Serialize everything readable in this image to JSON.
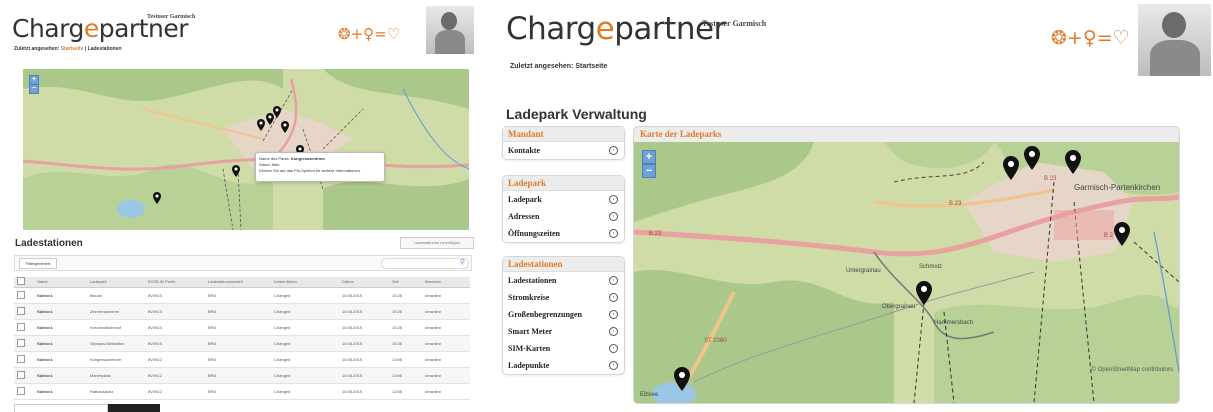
{
  "left": {
    "logo": {
      "pre": "Charg",
      "hi": "e",
      "post": "partner"
    },
    "user": "Testuser Garmisch",
    "deco": "❂+♀=♡",
    "breadcrumb": {
      "recent": "Zuletzt angesehen:",
      "current": "Startseite",
      "sep": "|",
      "other": "Ladestationen"
    },
    "map": {
      "zoom_in": "+",
      "zoom_out": "−",
      "popup": {
        "line1_pre": "Name des Parks:",
        "line1_name": "Kongresszentrum",
        "line2": "Stand: Italo",
        "line3": "Klicken Sie auf das Pin-Symbol für weitere Informationen."
      }
    },
    "section_title": "Ladestationen",
    "add_button": "Ladestationen hinzufügen",
    "filter_tab": "Filtergeneriert",
    "table": {
      "headers": [
        "",
        "Name",
        "Ladepark",
        "EVSE-ID Prefix",
        "Ladestationsmodell",
        "Letzte Aktion",
        "Datum",
        "Zeit",
        "Benutzer"
      ],
      "rows": [
        [
          "",
          "Station1",
          "Bisuse",
          "8V1€13",
          "BRS",
          "Changed",
          "15.06.2015",
          "13:26",
          "crowdinn"
        ],
        [
          "",
          "Station1",
          "Zinnermanzome",
          "8V1€13",
          "BRS",
          "Changed",
          "15.06.2015",
          "13:26",
          "crowdinn"
        ],
        [
          "",
          "Station1",
          "Kreuzeckbahnhof",
          "8V1€14",
          "BRS",
          "Changed",
          "15.06.2015",
          "13:26",
          "crowdinn"
        ],
        [
          "",
          "Station1",
          "Olympia-Skistadion",
          "8V1€15",
          "BRS",
          "Changed",
          "15.06.2015",
          "13:36",
          "crowdinn"
        ],
        [
          "",
          "Station1",
          "Kongresszentrum",
          "8V1€12",
          "BRS",
          "Changed",
          "15.06.2015",
          "13:66",
          "crowdinn"
        ],
        [
          "",
          "Station1",
          "Marienplatz",
          "8V1€12",
          "BRS",
          "Changed",
          "15.06.2015",
          "13:66",
          "crowdinn"
        ],
        [
          "",
          "Station1",
          "Rathausplatz",
          "8V1€12",
          "BRS",
          "Changed",
          "15.06.2015",
          "12:56",
          "crowdinn"
        ]
      ]
    }
  },
  "right": {
    "logo": {
      "pre": "Charg",
      "hi": "e",
      "post": "partner"
    },
    "user": "Testuser Garmisch",
    "deco": "❂+♀=♡",
    "breadcrumb": {
      "recent": "Zuletzt angesehen:",
      "current": "Startseite"
    },
    "page_title": "Ladepark Verwaltung",
    "groups": [
      {
        "title": "Mandant",
        "items": [
          "Kontakte"
        ]
      },
      {
        "title": "Ladepark",
        "items": [
          "Ladepark",
          "Adressen",
          "Öffnungszeiten"
        ]
      },
      {
        "title": "Ladestationen",
        "items": [
          "Ladestationen",
          "Stromkreise",
          "Großenbegrenzungen",
          "Smart Meter",
          "SIM-Karten",
          "Ladepunkte"
        ]
      }
    ],
    "map_title": "Karte der Ladeparks",
    "map": {
      "zoom_in": "+",
      "zoom_out": "−",
      "attribution": "© OpenStreetMap contributors",
      "towns": [
        "Garmisch-Partenkirchen",
        "Untergrainau",
        "Obergrainau",
        "Schmolz",
        "Hammersbach",
        "Eibsee"
      ],
      "roads": [
        "B 23",
        "B 23",
        "B 23",
        "B 2",
        "ST 2060"
      ]
    }
  },
  "colors": {
    "accent": "#e07b2a",
    "map_green": "#cfdca8",
    "map_forest": "#a9c88a",
    "road": "#e8a0a0"
  }
}
